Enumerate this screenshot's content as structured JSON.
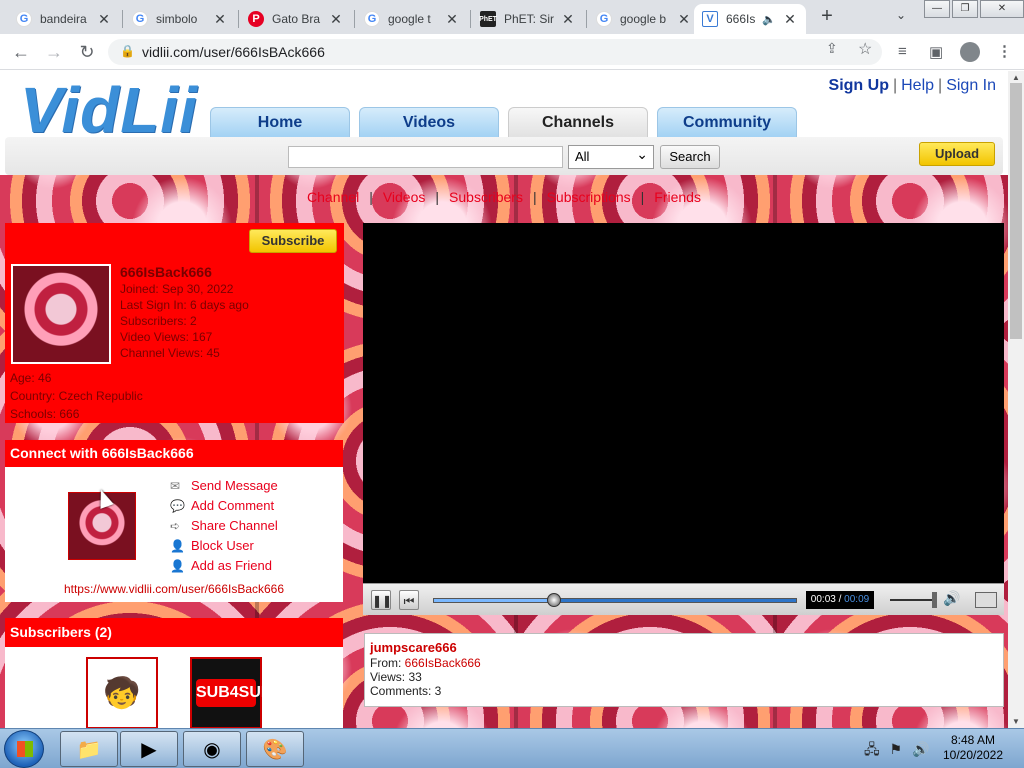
{
  "browser": {
    "tabs": [
      {
        "title": "bandeira",
        "icon": "google-icon"
      },
      {
        "title": "simbolo",
        "icon": "google-icon"
      },
      {
        "title": "Gato Bra",
        "icon": "pinterest-icon"
      },
      {
        "title": "google t",
        "icon": "google-icon"
      },
      {
        "title": "PhET: Sir",
        "icon": "phet-icon"
      },
      {
        "title": "google b",
        "icon": "google-icon"
      },
      {
        "title": "666Is",
        "icon": "vidlii-icon"
      }
    ],
    "url": "vidlii.com/user/666IsBAck666"
  },
  "site": {
    "logo": "VidLii",
    "user_links": {
      "signup": "Sign Up",
      "help": "Help",
      "signin": "Sign In"
    },
    "nav": [
      "Home",
      "Videos",
      "Channels",
      "Community"
    ],
    "search": {
      "category": "All",
      "button": "Search"
    },
    "upload": "Upload"
  },
  "channel_links": [
    "Channel",
    "Videos",
    "Subscribers",
    "Subscriptions",
    "Friends"
  ],
  "profile": {
    "subscribe": "Subscribe",
    "username": "666IsBack666",
    "joined": "Joined: Sep 30, 2022",
    "last_sign_in": "Last Sign In: 6 days ago",
    "subscribers": "Subscribers: 2",
    "video_views": "Video Views: 167",
    "channel_views": "Channel Views: 45",
    "age": "Age: 46",
    "country": "Country: Czech Republic",
    "school": "Schools: 666"
  },
  "connect": {
    "heading": "Connect with 666IsBack666",
    "actions": [
      "Send Message",
      "Add Comment",
      "Share Channel",
      "Block User",
      "Add as Friend"
    ],
    "url": "https://www.vidlii.com/user/666IsBack666"
  },
  "subscribers_box": {
    "heading": "Subscribers (2)",
    "badge_text": "SUB4SUB"
  },
  "player": {
    "current": "00:03",
    "total": "00:09",
    "progress_fraction": 0.33,
    "volume_fraction": 0.95
  },
  "video": {
    "title": "jumpscare666",
    "from_label": "From: ",
    "from_user": "666IsBack666",
    "views": "Views: 33",
    "comments": "Comments: 3"
  },
  "taskbar": {
    "time": "8:48 AM",
    "date": "10/20/2022"
  }
}
